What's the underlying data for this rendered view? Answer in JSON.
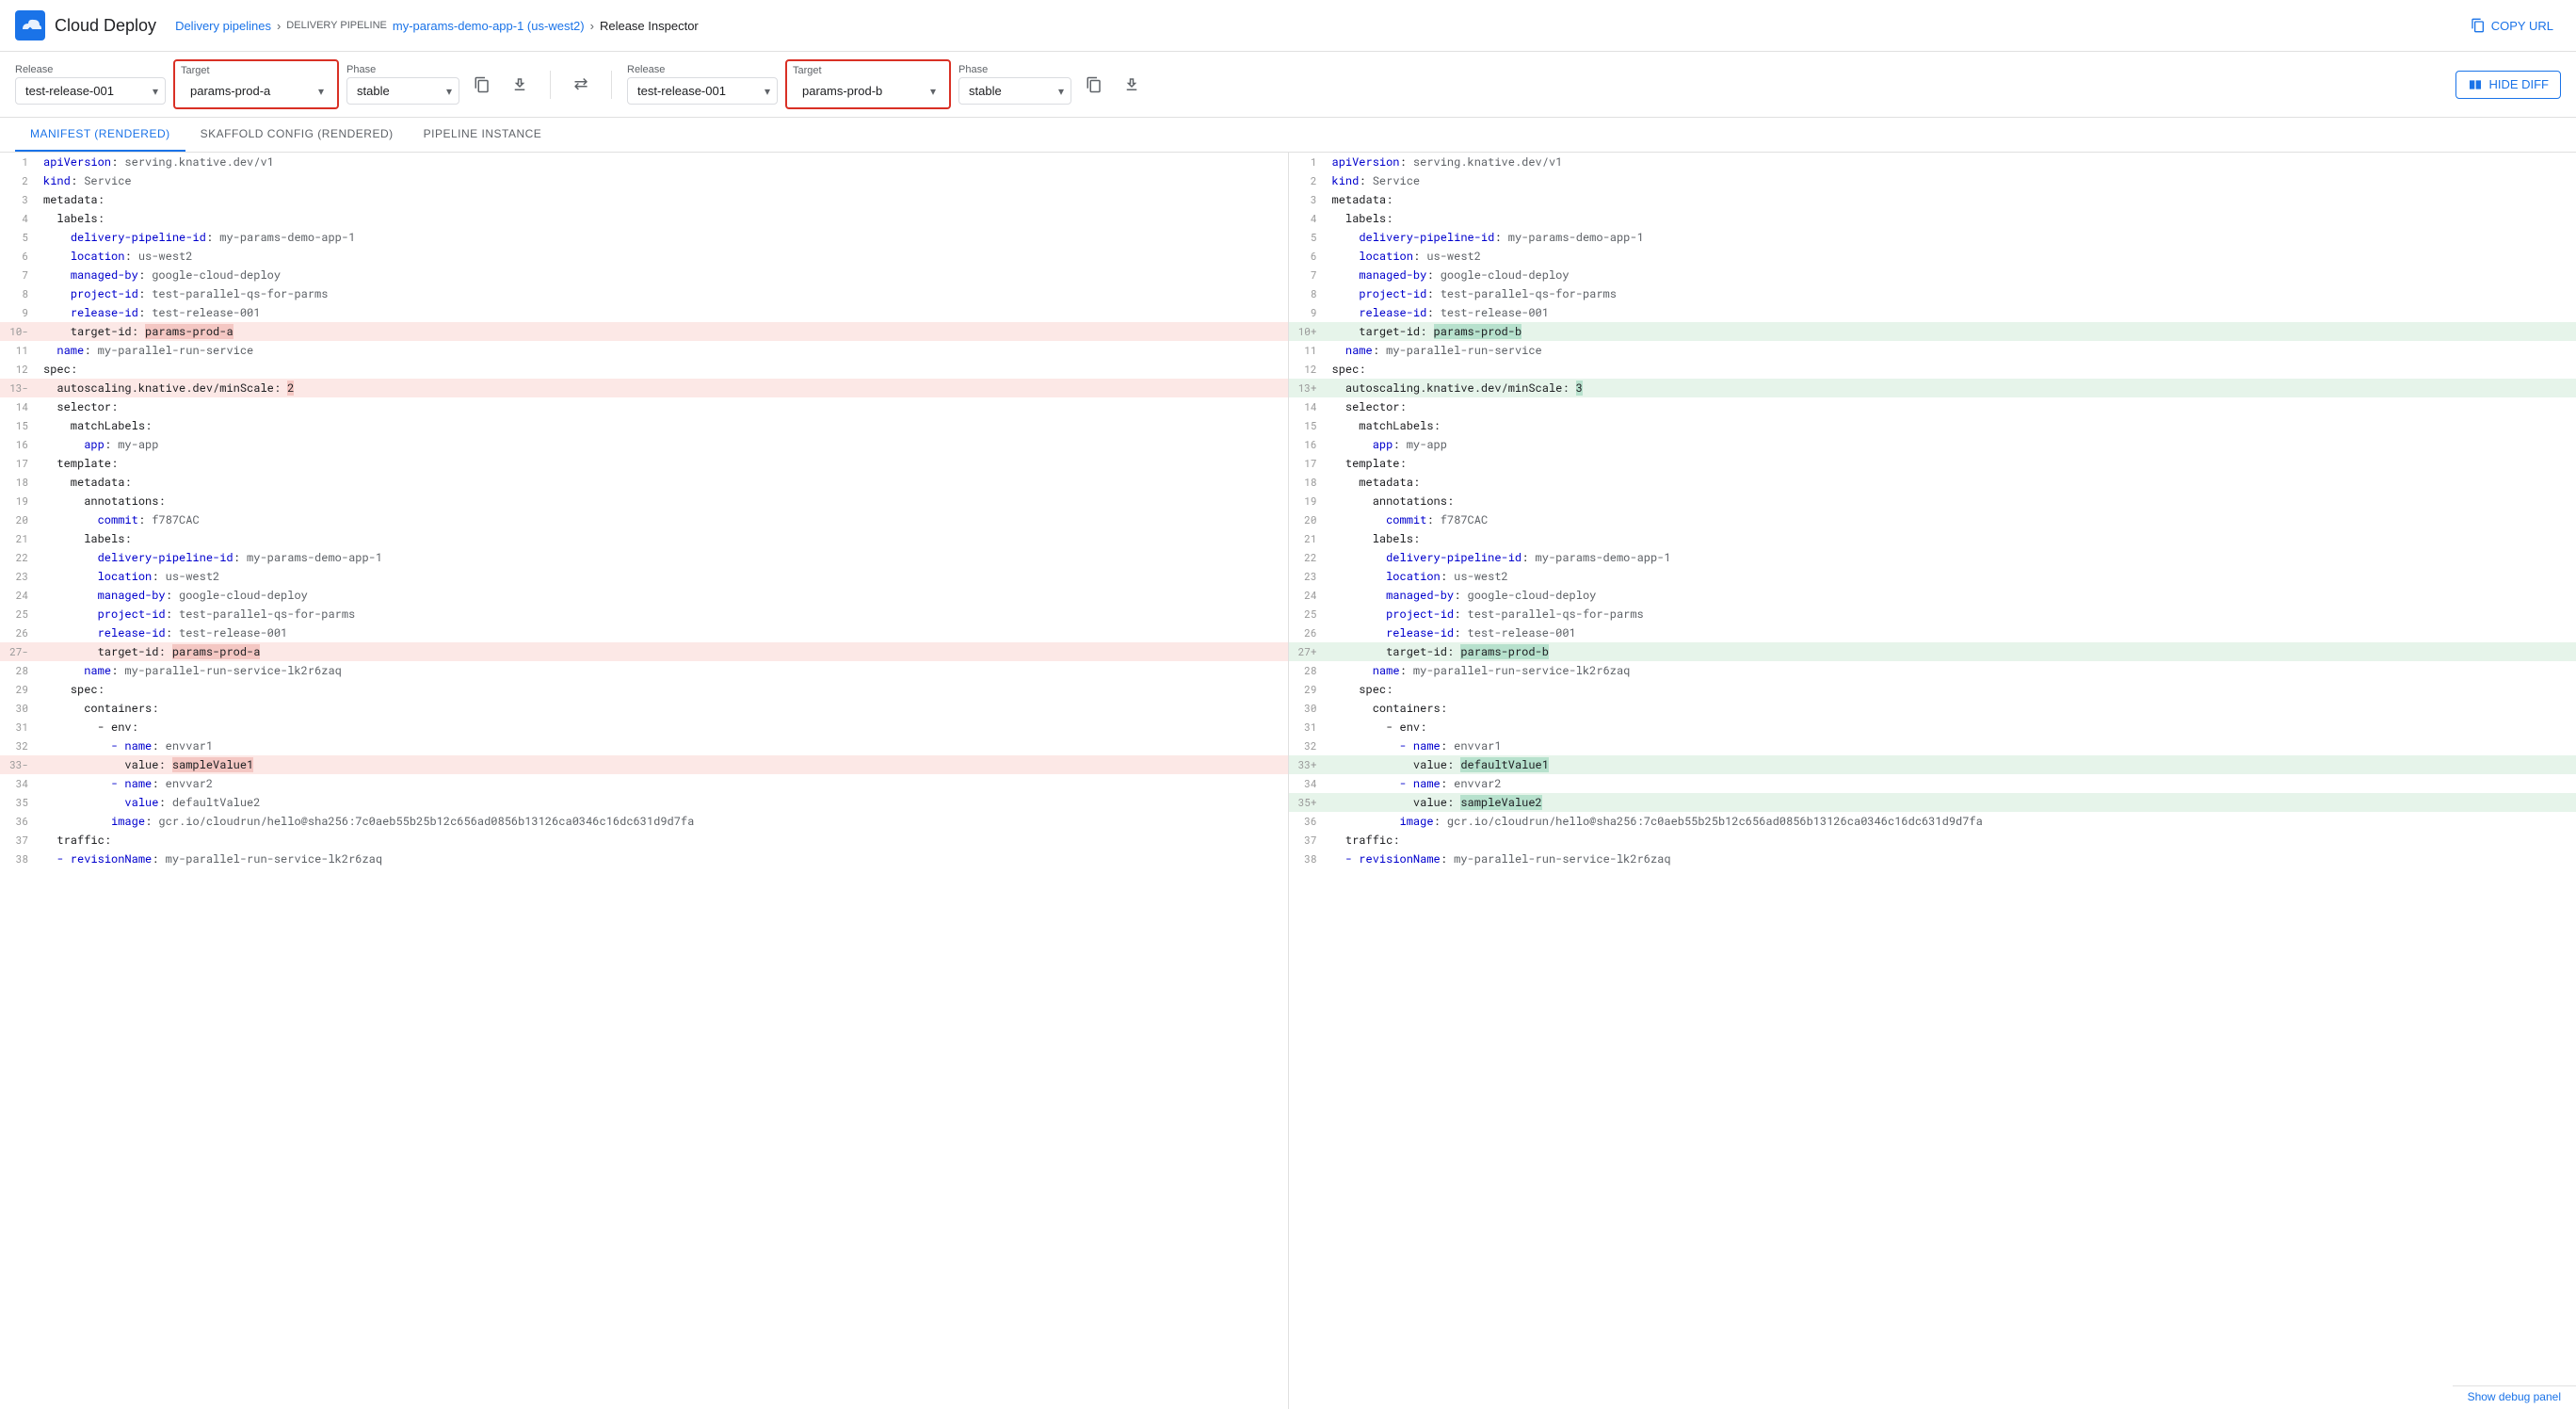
{
  "header": {
    "logo_text": "Cloud Deploy",
    "breadcrumb": {
      "delivery_pipelines": "Delivery pipelines",
      "pipeline_name": "my-params-demo-app-1 (us-west2)",
      "release_inspector": "Release Inspector"
    },
    "copy_url_label": "COPY URL"
  },
  "left_panel": {
    "release_label": "Release",
    "release_value": "test-release-001",
    "target_label": "Target",
    "target_value": "params-prod-a",
    "phase_label": "Phase",
    "phase_value": "stable",
    "highlighted": true
  },
  "right_panel": {
    "release_label": "Release",
    "release_value": "test-release-001",
    "target_label": "Target",
    "target_value": "params-prod-b",
    "phase_label": "Phase",
    "phase_value": "stable",
    "highlighted": true
  },
  "hide_diff_label": "HIDE DIFF",
  "tabs": [
    {
      "label": "MANIFEST (RENDERED)",
      "active": true
    },
    {
      "label": "SKAFFOLD CONFIG (RENDERED)",
      "active": false
    },
    {
      "label": "PIPELINE INSTANCE",
      "active": false
    }
  ],
  "left_code": [
    {
      "num": 1,
      "content": "apiVersion: serving.knative.dev/v1",
      "type": "normal"
    },
    {
      "num": 2,
      "content": "kind: Service",
      "type": "normal"
    },
    {
      "num": 3,
      "content": "metadata:",
      "type": "normal"
    },
    {
      "num": 4,
      "content": "  labels:",
      "type": "normal"
    },
    {
      "num": 5,
      "content": "    delivery-pipeline-id: my-params-demo-app-1",
      "type": "normal"
    },
    {
      "num": 6,
      "content": "    location: us-west2",
      "type": "normal"
    },
    {
      "num": 7,
      "content": "    managed-by: google-cloud-deploy",
      "type": "normal"
    },
    {
      "num": 8,
      "content": "    project-id: test-parallel-qs-for-parms",
      "type": "normal"
    },
    {
      "num": 9,
      "content": "    release-id: test-release-001",
      "type": "normal"
    },
    {
      "num": 10,
      "content": "    target-id: params-prod-a",
      "type": "removed",
      "marker": "-"
    },
    {
      "num": 11,
      "content": "  name: my-parallel-run-service",
      "type": "normal"
    },
    {
      "num": 12,
      "content": "spec:",
      "type": "normal"
    },
    {
      "num": 13,
      "content": "  autoscaling.knative.dev/minScale: 2",
      "type": "removed",
      "marker": "-"
    },
    {
      "num": 14,
      "content": "  selector:",
      "type": "normal"
    },
    {
      "num": 15,
      "content": "    matchLabels:",
      "type": "normal"
    },
    {
      "num": 16,
      "content": "      app: my-app",
      "type": "normal"
    },
    {
      "num": 17,
      "content": "  template:",
      "type": "normal"
    },
    {
      "num": 18,
      "content": "    metadata:",
      "type": "normal"
    },
    {
      "num": 19,
      "content": "      annotations:",
      "type": "normal"
    },
    {
      "num": 20,
      "content": "        commit: f787CAC",
      "type": "normal"
    },
    {
      "num": 21,
      "content": "      labels:",
      "type": "normal"
    },
    {
      "num": 22,
      "content": "        delivery-pipeline-id: my-params-demo-app-1",
      "type": "normal"
    },
    {
      "num": 23,
      "content": "        location: us-west2",
      "type": "normal"
    },
    {
      "num": 24,
      "content": "        managed-by: google-cloud-deploy",
      "type": "normal"
    },
    {
      "num": 25,
      "content": "        project-id: test-parallel-qs-for-parms",
      "type": "normal"
    },
    {
      "num": 26,
      "content": "        release-id: test-release-001",
      "type": "normal"
    },
    {
      "num": 27,
      "content": "        target-id: params-prod-a",
      "type": "removed",
      "marker": "-"
    },
    {
      "num": 28,
      "content": "      name: my-parallel-run-service-lk2r6zaq",
      "type": "normal"
    },
    {
      "num": 29,
      "content": "    spec:",
      "type": "normal"
    },
    {
      "num": 30,
      "content": "      containers:",
      "type": "normal"
    },
    {
      "num": 31,
      "content": "        - env:",
      "type": "normal"
    },
    {
      "num": 32,
      "content": "          - name: envvar1",
      "type": "normal"
    },
    {
      "num": 33,
      "content": "            value: sampleValue1",
      "type": "removed",
      "marker": "-"
    },
    {
      "num": 34,
      "content": "          - name: envvar2",
      "type": "normal"
    },
    {
      "num": 35,
      "content": "            value: defaultValue2",
      "type": "normal"
    },
    {
      "num": 36,
      "content": "          image: gcr.io/cloudrun/hello@sha256:7c0aeb55b25b12c656ad0856b13126ca0346c16dc631d9d7fa",
      "type": "normal"
    },
    {
      "num": 37,
      "content": "  traffic:",
      "type": "normal"
    },
    {
      "num": 38,
      "content": "  - revisionName: my-parallel-run-service-lk2r6zaq",
      "type": "normal"
    }
  ],
  "right_code": [
    {
      "num": 1,
      "content": "apiVersion: serving.knative.dev/v1",
      "type": "normal"
    },
    {
      "num": 2,
      "content": "kind: Service",
      "type": "normal"
    },
    {
      "num": 3,
      "content": "metadata:",
      "type": "normal"
    },
    {
      "num": 4,
      "content": "  labels:",
      "type": "normal"
    },
    {
      "num": 5,
      "content": "    delivery-pipeline-id: my-params-demo-app-1",
      "type": "normal"
    },
    {
      "num": 6,
      "content": "    location: us-west2",
      "type": "normal"
    },
    {
      "num": 7,
      "content": "    managed-by: google-cloud-deploy",
      "type": "normal"
    },
    {
      "num": 8,
      "content": "    project-id: test-parallel-qs-for-parms",
      "type": "normal"
    },
    {
      "num": 9,
      "content": "    release-id: test-release-001",
      "type": "normal"
    },
    {
      "num": 10,
      "content": "    target-id: params-prod-b",
      "type": "added",
      "marker": "+"
    },
    {
      "num": 11,
      "content": "  name: my-parallel-run-service",
      "type": "normal"
    },
    {
      "num": 12,
      "content": "spec:",
      "type": "normal"
    },
    {
      "num": 13,
      "content": "  autoscaling.knative.dev/minScale: 3",
      "type": "added",
      "marker": "+"
    },
    {
      "num": 14,
      "content": "  selector:",
      "type": "normal"
    },
    {
      "num": 15,
      "content": "    matchLabels:",
      "type": "normal"
    },
    {
      "num": 16,
      "content": "      app: my-app",
      "type": "normal"
    },
    {
      "num": 17,
      "content": "  template:",
      "type": "normal"
    },
    {
      "num": 18,
      "content": "    metadata:",
      "type": "normal"
    },
    {
      "num": 19,
      "content": "      annotations:",
      "type": "normal"
    },
    {
      "num": 20,
      "content": "        commit: f787CAC",
      "type": "normal"
    },
    {
      "num": 21,
      "content": "      labels:",
      "type": "normal"
    },
    {
      "num": 22,
      "content": "        delivery-pipeline-id: my-params-demo-app-1",
      "type": "normal"
    },
    {
      "num": 23,
      "content": "        location: us-west2",
      "type": "normal"
    },
    {
      "num": 24,
      "content": "        managed-by: google-cloud-deploy",
      "type": "normal"
    },
    {
      "num": 25,
      "content": "        project-id: test-parallel-qs-for-parms",
      "type": "normal"
    },
    {
      "num": 26,
      "content": "        release-id: test-release-001",
      "type": "normal"
    },
    {
      "num": 27,
      "content": "        target-id: params-prod-b",
      "type": "added",
      "marker": "+"
    },
    {
      "num": 28,
      "content": "      name: my-parallel-run-service-lk2r6zaq",
      "type": "normal"
    },
    {
      "num": 29,
      "content": "    spec:",
      "type": "normal"
    },
    {
      "num": 30,
      "content": "      containers:",
      "type": "normal"
    },
    {
      "num": 31,
      "content": "        - env:",
      "type": "normal"
    },
    {
      "num": 32,
      "content": "          - name: envvar1",
      "type": "normal"
    },
    {
      "num": 33,
      "content": "            value: defaultValue1",
      "type": "added",
      "marker": "+"
    },
    {
      "num": 34,
      "content": "          - name: envvar2",
      "type": "normal"
    },
    {
      "num": 35,
      "content": "            value: sampleValue2",
      "type": "added",
      "marker": "+"
    },
    {
      "num": 36,
      "content": "          image: gcr.io/cloudrun/hello@sha256:7c0aeb55b25b12c656ad0856b13126ca0346c16dc631d9d7fa",
      "type": "normal"
    },
    {
      "num": 37,
      "content": "  traffic:",
      "type": "normal"
    },
    {
      "num": 38,
      "content": "  - revisionName: my-parallel-run-service-lk2r6zaq",
      "type": "normal"
    }
  ],
  "bottom_bar_label": "Show debug panel",
  "colors": {
    "accent": "#1a73e8",
    "removed_bg": "#fce8e6",
    "added_bg": "#e6f4ea",
    "diff_red": "#ea4335",
    "diff_green": "#34a853",
    "border": "#e0e0e0"
  }
}
